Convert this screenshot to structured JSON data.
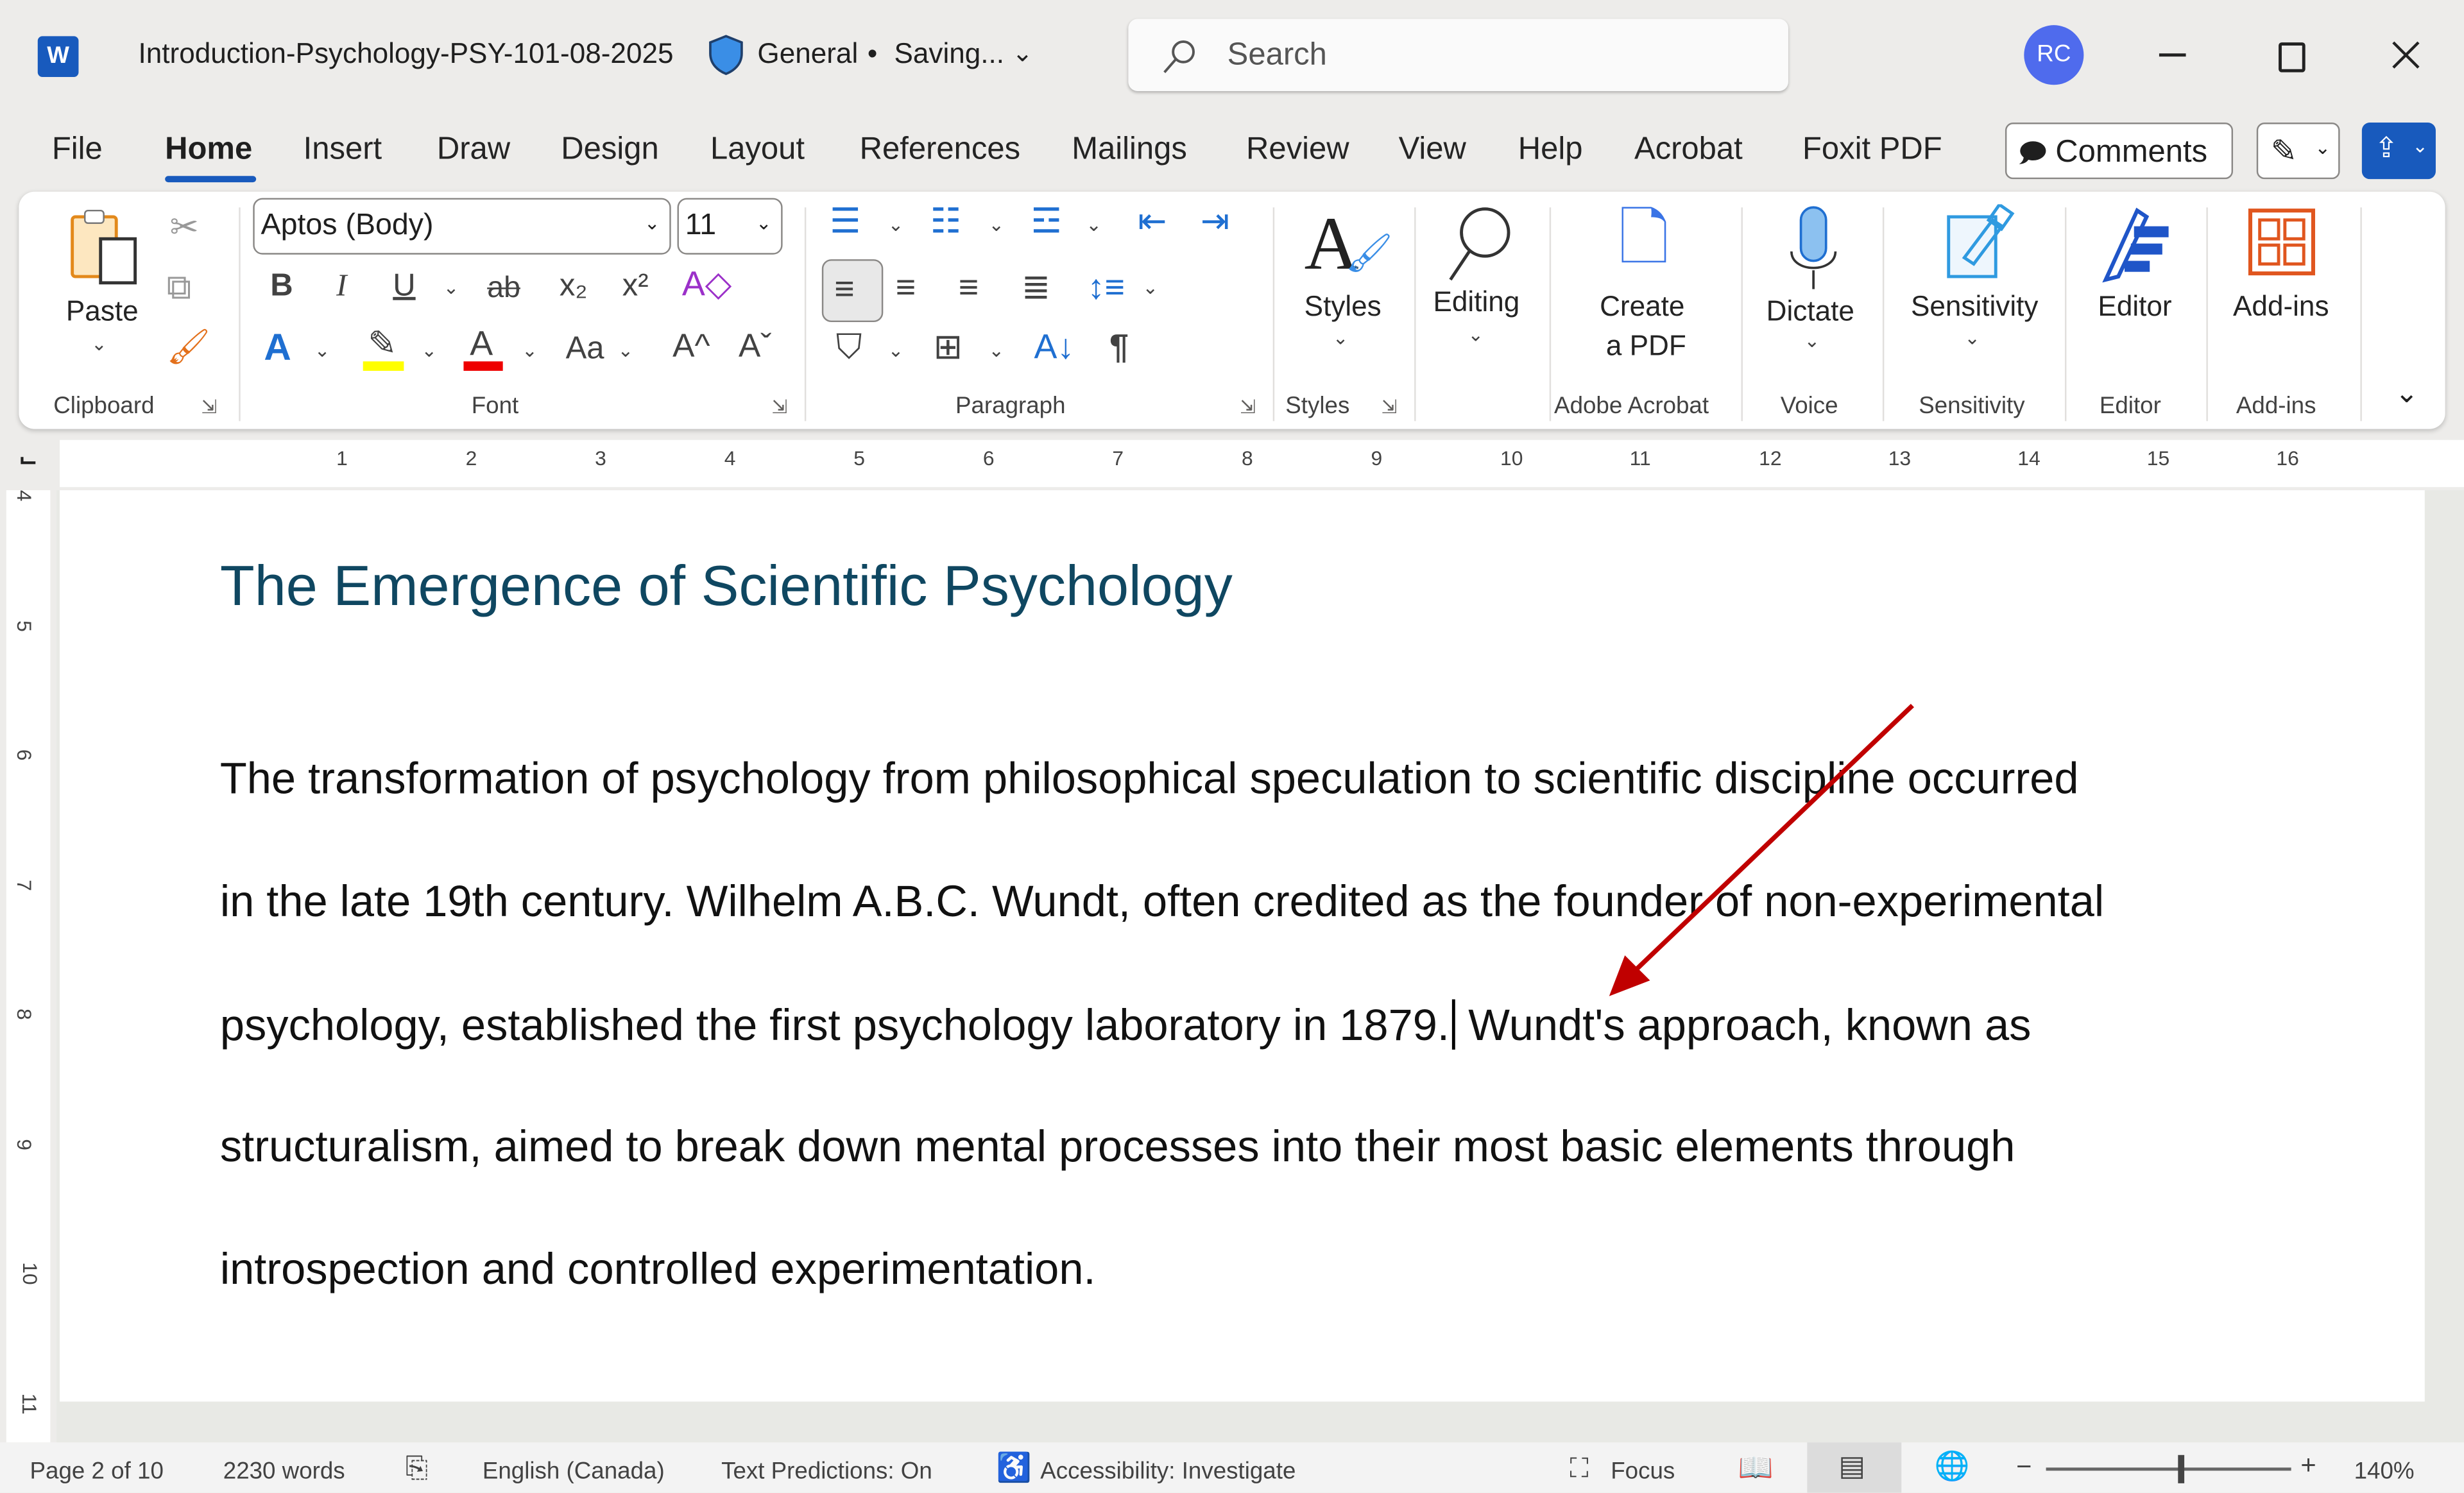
{
  "titlebar": {
    "document_title": "Introduction-Psychology-PSY-101-08-2025",
    "sensitivity_label": "General",
    "save_status": "Saving...",
    "separator": "•",
    "search_placeholder": "Search",
    "avatar_initials": "RC",
    "avatar_color": "#4f6bed"
  },
  "tabs": [
    "File",
    "Home",
    "Insert",
    "Draw",
    "Design",
    "Layout",
    "References",
    "Mailings",
    "Review",
    "View",
    "Help",
    "Acrobat",
    "Foxit PDF"
  ],
  "active_tab": "Home",
  "actions": {
    "comments_label": "Comments"
  },
  "ribbon": {
    "clipboard": {
      "paste": "Paste",
      "group": "Clipboard"
    },
    "font": {
      "font_name": "Aptos (Body)",
      "font_size": "11",
      "group": "Font",
      "bold": "B",
      "italic": "I",
      "underline": "U",
      "strike": "ab",
      "subscript": "x₂",
      "superscript": "x²",
      "change_case": "Aa",
      "grow": "A^",
      "shrink": "Aˇ",
      "font_color": "A",
      "text_effects": "A"
    },
    "paragraph": {
      "group": "Paragraph",
      "pilcrow": "¶"
    },
    "styles": {
      "label": "Styles",
      "group": "Styles"
    },
    "editing": {
      "label": "Editing"
    },
    "acrobat": {
      "label_line1": "Create",
      "label_line2": "a PDF",
      "group": "Adobe Acrobat"
    },
    "voice": {
      "label": "Dictate",
      "group": "Voice"
    },
    "sensitivity": {
      "label": "Sensitivity",
      "group": "Sensitivity"
    },
    "editor": {
      "label": "Editor",
      "group": "Editor"
    },
    "addins": {
      "label": "Add-ins",
      "group": "Add-ins"
    }
  },
  "ruler": {
    "numbers": [
      "1",
      "2",
      "3",
      "4",
      "5",
      "6",
      "7",
      "8",
      "9",
      "10",
      "11",
      "12",
      "13",
      "14",
      "15",
      "16"
    ],
    "vertical_numbers": [
      "4",
      "5",
      "6",
      "7",
      "8",
      "9",
      "10",
      "11"
    ]
  },
  "document": {
    "heading": "The Emergence of Scientific Psychology",
    "lines": [
      "The transformation of psychology from philosophical speculation to scientific discipline occurred",
      "in the late 19th century. Wilhelm A.B.C. Wundt, often credited as the founder of non-experimental",
      "psychology, established the first psychology laboratory in 1879.",
      "structuralism, aimed to break down mental processes into their most basic elements through",
      "introspection and controlled experimentation."
    ],
    "line3_after_cursor": "Wundt's approach, known as",
    "heading_color": "#0f4761",
    "annotation_arrow_color": "#c00000"
  },
  "status": {
    "page": "Page 2 of 10",
    "words": "2230 words",
    "language": "English (Canada)",
    "predictions": "Text Predictions: On",
    "accessibility": "Accessibility: Investigate",
    "focus": "Focus",
    "zoom": "140%",
    "zoom_percent": 140
  }
}
